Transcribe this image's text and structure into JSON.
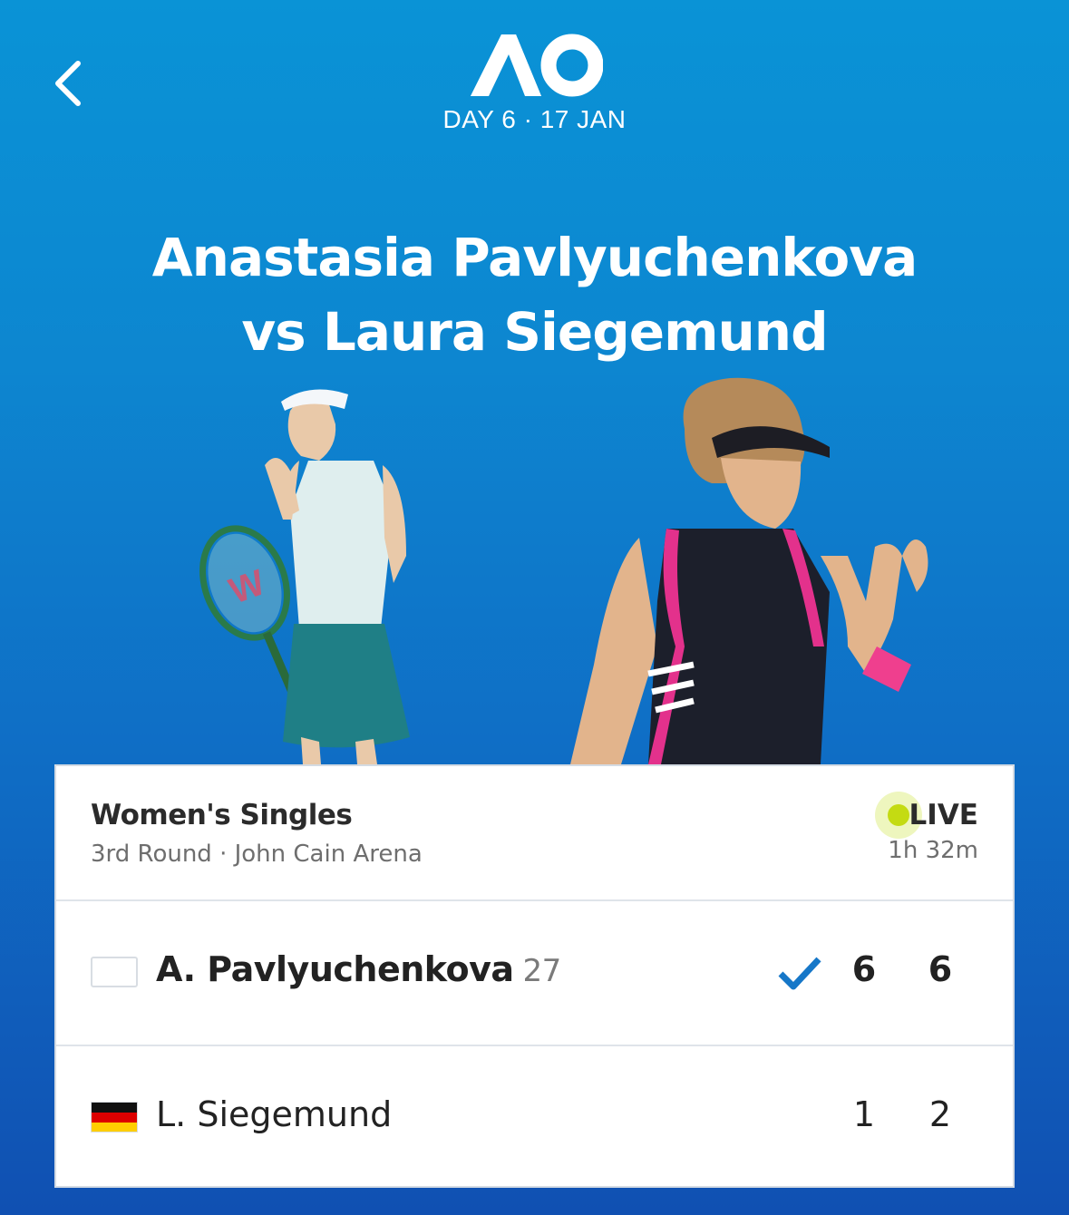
{
  "header": {
    "back_icon": "chevron-left-icon",
    "logo_text": "AO",
    "day_label": "DAY 6 · 17 JAN"
  },
  "match": {
    "title_line1": "Anastasia Pavlyuchenkova",
    "title_line2": "vs Laura Siegemund"
  },
  "card": {
    "event": "Women's Singles",
    "round_venue": "3rd Round · John Cain Arena",
    "status": "LIVE",
    "duration": "1h 32m",
    "live_color": "#c4db12",
    "players": [
      {
        "name": "A. Pavlyuchenkova",
        "seed": "27",
        "flag": "blank",
        "winner": true,
        "sets": [
          "6",
          "6"
        ]
      },
      {
        "name": "L. Siegemund",
        "seed": "",
        "flag": "germany",
        "winner": false,
        "sets": [
          "1",
          "2"
        ]
      }
    ]
  },
  "colors": {
    "background_top": "#0a93d6",
    "background_bottom": "#1050b2",
    "check": "#1677c8"
  }
}
